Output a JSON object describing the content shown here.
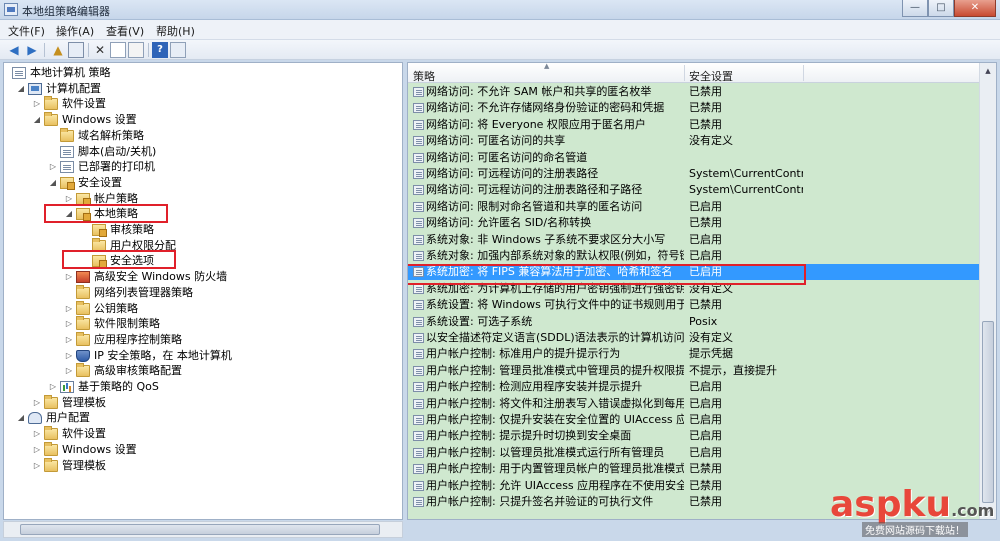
{
  "window": {
    "title": "本地组策略编辑器",
    "buttons": {
      "minimize": "—",
      "maximize": "□",
      "close": "✕"
    }
  },
  "menu": [
    "文件(F)",
    "操作(A)",
    "查看(V)",
    "帮助(H)"
  ],
  "toolbar_icons": [
    "back-arrow-icon",
    "forward-arrow-icon",
    "up-folder-icon",
    "show-hide-tree-icon",
    "delete-icon",
    "properties-icon",
    "export-list-icon",
    "help-icon",
    "show-hide-action-pane-icon"
  ],
  "tree": [
    {
      "label": "本地计算机 策略",
      "icon": "doc",
      "level": 0,
      "arrow": ""
    },
    {
      "label": "计算机配置",
      "icon": "computer",
      "level": 1,
      "arrow": "◢"
    },
    {
      "label": "软件设置",
      "icon": "folder",
      "level": 2,
      "arrow": "▷"
    },
    {
      "label": "Windows 设置",
      "icon": "folder",
      "level": 2,
      "arrow": "◢"
    },
    {
      "label": "域名解析策略",
      "icon": "folder",
      "level": 3,
      "arrow": ""
    },
    {
      "label": "脚本(启动/关机)",
      "icon": "doc",
      "level": 3,
      "arrow": ""
    },
    {
      "label": "已部署的打印机",
      "icon": "doc",
      "level": 3,
      "arrow": "▷"
    },
    {
      "label": "安全设置",
      "icon": "lock",
      "level": 3,
      "arrow": "◢"
    },
    {
      "label": "帐户策略",
      "icon": "lock",
      "level": 4,
      "arrow": "▷"
    },
    {
      "label": "本地策略",
      "icon": "lock",
      "level": 4,
      "arrow": "◢"
    },
    {
      "label": "审核策略",
      "icon": "lock",
      "level": 5,
      "arrow": ""
    },
    {
      "label": "用户权限分配",
      "icon": "folder",
      "level": 5,
      "arrow": ""
    },
    {
      "label": "安全选项",
      "icon": "lock",
      "level": 5,
      "arrow": ""
    },
    {
      "label": "高级安全 Windows 防火墙",
      "icon": "firewall",
      "level": 4,
      "arrow": "▷"
    },
    {
      "label": "网络列表管理器策略",
      "icon": "folder",
      "level": 4,
      "arrow": ""
    },
    {
      "label": "公钥策略",
      "icon": "folder",
      "level": 4,
      "arrow": "▷"
    },
    {
      "label": "软件限制策略",
      "icon": "folder",
      "level": 4,
      "arrow": "▷"
    },
    {
      "label": "应用程序控制策略",
      "icon": "folder",
      "level": 4,
      "arrow": "▷"
    },
    {
      "label": "IP 安全策略，在 本地计算机",
      "icon": "shield",
      "level": 4,
      "arrow": "▷"
    },
    {
      "label": "高级审核策略配置",
      "icon": "folder",
      "level": 4,
      "arrow": "▷"
    },
    {
      "label": "基于策略的 QoS",
      "icon": "chart",
      "level": 3,
      "arrow": "▷"
    },
    {
      "label": "管理模板",
      "icon": "folder",
      "level": 2,
      "arrow": "▷"
    },
    {
      "label": "用户配置",
      "icon": "user",
      "level": 1,
      "arrow": "◢"
    },
    {
      "label": "软件设置",
      "icon": "folder",
      "level": 2,
      "arrow": "▷"
    },
    {
      "label": "Windows 设置",
      "icon": "folder",
      "level": 2,
      "arrow": "▷"
    },
    {
      "label": "管理模板",
      "icon": "folder",
      "level": 2,
      "arrow": "▷"
    }
  ],
  "columns": {
    "policy": "策略",
    "setting": "安全设置"
  },
  "policies": [
    {
      "name": "网络访问: 不允许 SAM 帐户和共享的匿名枚举",
      "setting": "已禁用"
    },
    {
      "name": "网络访问: 不允许存储网络身份验证的密码和凭据",
      "setting": "已禁用"
    },
    {
      "name": "网络访问: 将 Everyone 权限应用于匿名用户",
      "setting": "已禁用"
    },
    {
      "name": "网络访问: 可匿名访问的共享",
      "setting": "没有定义"
    },
    {
      "name": "网络访问: 可匿名访问的命名管道",
      "setting": ""
    },
    {
      "name": "网络访问: 可远程访问的注册表路径",
      "setting": "System\\CurrentContro..."
    },
    {
      "name": "网络访问: 可远程访问的注册表路径和子路径",
      "setting": "System\\CurrentContro..."
    },
    {
      "name": "网络访问: 限制对命名管道和共享的匿名访问",
      "setting": "已启用"
    },
    {
      "name": "网络访问: 允许匿名 SID/名称转换",
      "setting": "已禁用"
    },
    {
      "name": "系统对象: 非 Windows 子系统不要求区分大小写",
      "setting": "已启用"
    },
    {
      "name": "系统对象: 加强内部系统对象的默认权限(例如，符号链接)",
      "setting": "已启用"
    },
    {
      "name": "系统加密: 将 FIPS 兼容算法用于加密、哈希和签名",
      "setting": "已启用"
    },
    {
      "name": "系统加密: 为计算机上存储的用户密钥强制进行强密钥保护",
      "setting": "没有定义"
    },
    {
      "name": "系统设置: 将 Windows 可执行文件中的证书规则用于软件...",
      "setting": "已禁用"
    },
    {
      "name": "系统设置: 可选子系统",
      "setting": "Posix"
    },
    {
      "name": "以安全描述符定义语言(SDDL)语法表示的计算机访问限制",
      "setting": "没有定义"
    },
    {
      "name": "用户帐户控制: 标准用户的提升提示行为",
      "setting": "提示凭据"
    },
    {
      "name": "用户帐户控制: 管理员批准模式中管理员的提升权限提示的...",
      "setting": "不提示，直接提升"
    },
    {
      "name": "用户帐户控制: 检测应用程序安装并提示提升",
      "setting": "已启用"
    },
    {
      "name": "用户帐户控制: 将文件和注册表写入错误虚拟化到每用户位置",
      "setting": "已启用"
    },
    {
      "name": "用户帐户控制: 仅提升安装在安全位置的 UIAccess 应用程序",
      "setting": "已启用"
    },
    {
      "name": "用户帐户控制: 提示提升时切换到安全桌面",
      "setting": "已启用"
    },
    {
      "name": "用户帐户控制: 以管理员批准模式运行所有管理员",
      "setting": "已启用"
    },
    {
      "name": "用户帐户控制: 用于内置管理员帐户的管理员批准模式",
      "setting": "已禁用"
    },
    {
      "name": "用户帐户控制: 允许 UIAccess 应用程序在不使用安全桌面...",
      "setting": "已禁用"
    },
    {
      "name": "用户帐户控制: 只提升签名并验证的可执行文件",
      "setting": "已禁用"
    }
  ],
  "selected_policy_index": 11,
  "colors": {
    "pane_bg": "#cfe8cf",
    "selection": "#3399ff",
    "highlight_box": "#e0202a"
  },
  "watermark": {
    "main": "aspku",
    "suffix": ".com",
    "sub": "免费网站源码下载站！"
  }
}
